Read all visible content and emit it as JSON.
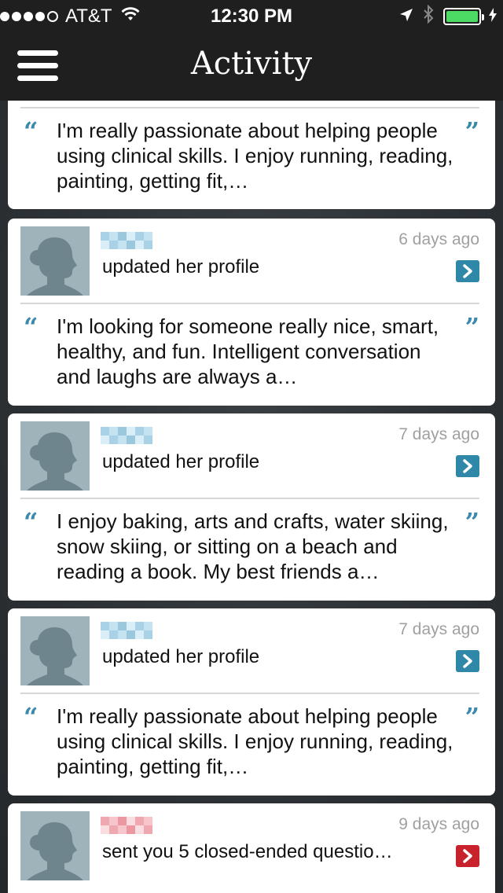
{
  "status_bar": {
    "carrier": "AT&T",
    "time": "12:30 PM",
    "signal_bars": 4,
    "battery_level": 1.0
  },
  "nav": {
    "title": "Activity",
    "menu_icon": "hamburger-menu-icon"
  },
  "colors": {
    "bar_bg": "#1f1f1f",
    "accent_blue": "#2f88a8",
    "accent_red": "#c8222c",
    "quote_blue": "#3a8aaa",
    "timestamp_gray": "#a0a0a0",
    "battery_green": "#4cd964"
  },
  "feed": {
    "partial_quote": {
      "text": "I'm really passionate about helping people using clinical skills.  I enjoy running, reading, painting, getting fit,…"
    },
    "items": [
      {
        "time_ago": "6 days ago",
        "action": "updated her profile",
        "quote": "I'm looking for someone really nice, smart, healthy, and fun.  Intelligent conversation and laughs are always a…",
        "arrow_color": "blue"
      },
      {
        "time_ago": "7 days ago",
        "action": "updated her profile",
        "quote": "I enjoy baking, arts and crafts, water skiing, snow skiing, or sitting on a beach and reading a book. My best friends a…",
        "arrow_color": "blue"
      },
      {
        "time_ago": "7 days ago",
        "action": "updated her profile",
        "quote": "I'm really passionate about helping people using clinical skills.  I enjoy running, reading, painting, getting fit,…",
        "arrow_color": "blue"
      },
      {
        "time_ago": "9 days ago",
        "action": "sent you 5 closed-ended questio…",
        "arrow_color": "red"
      }
    ]
  }
}
